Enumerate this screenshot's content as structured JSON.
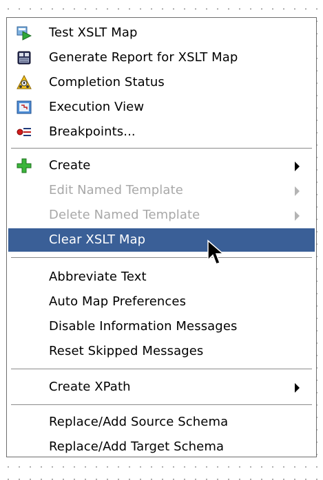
{
  "menu": {
    "items": [
      {
        "label": "Test XSLT Map",
        "icon": "test-map-icon"
      },
      {
        "label": "Generate Report for XSLT Map",
        "icon": "report-icon"
      },
      {
        "label": "Completion Status",
        "icon": "warning-icon"
      },
      {
        "label": "Execution View",
        "icon": "execution-view-icon"
      },
      {
        "label": "Breakpoints...",
        "icon": "breakpoints-icon"
      },
      {
        "label": "Create",
        "icon": "plus-icon",
        "submenu": true
      },
      {
        "label": "Edit Named Template",
        "disabled": true,
        "submenu": true
      },
      {
        "label": "Delete Named Template",
        "disabled": true,
        "submenu": true
      },
      {
        "label": "Clear XSLT Map",
        "selected": true
      },
      {
        "label": "Abbreviate Text"
      },
      {
        "label": "Auto Map Preferences"
      },
      {
        "label": "Disable Information Messages"
      },
      {
        "label": "Reset Skipped Messages"
      },
      {
        "label": "Create XPath",
        "submenu": true
      },
      {
        "label": "Replace/Add Source Schema"
      },
      {
        "label": "Replace/Add Target Schema"
      }
    ]
  },
  "colors": {
    "selection": "#3a5f97",
    "disabled_text": "#a8a8a8",
    "separator": "#8a8a8a"
  }
}
